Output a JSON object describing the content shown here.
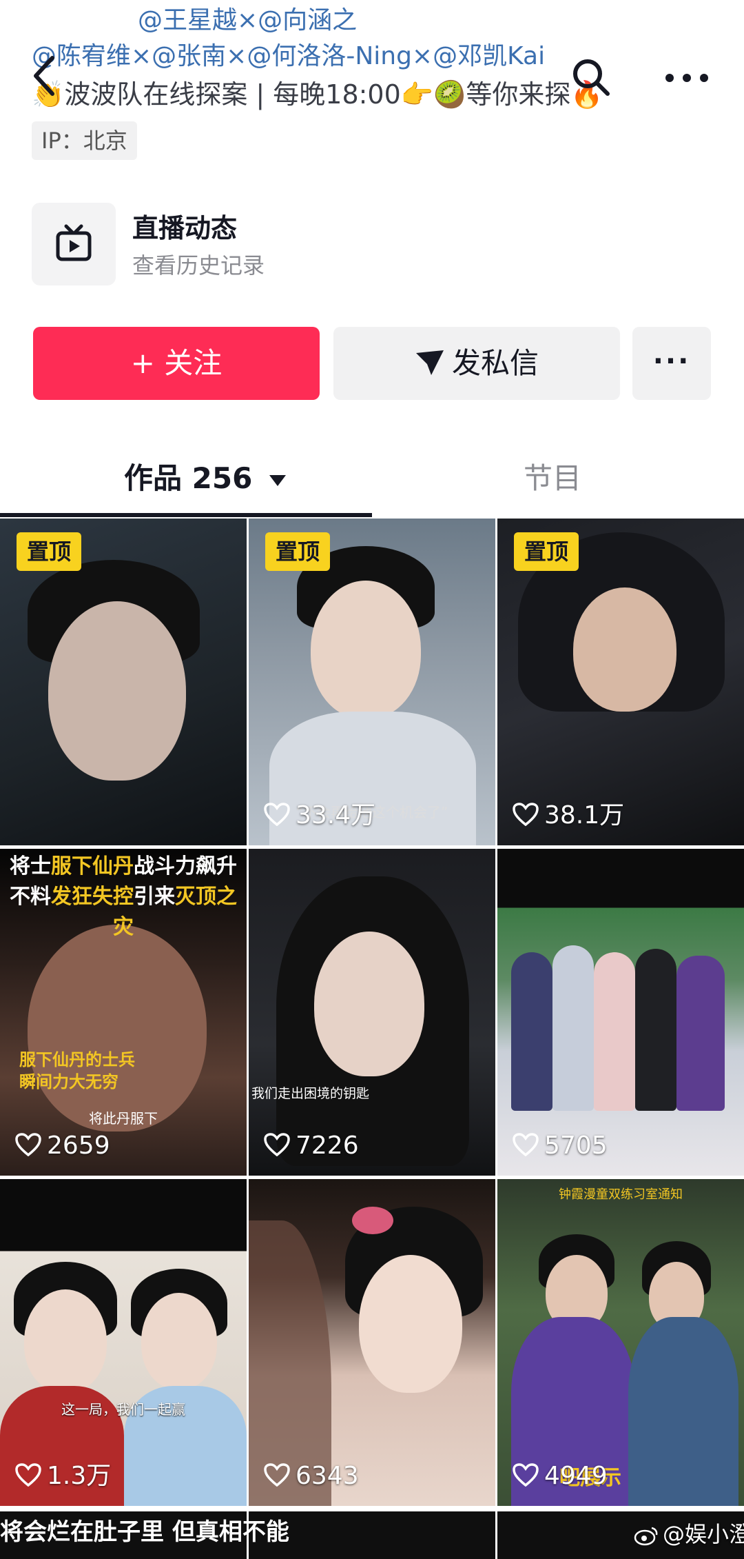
{
  "header": {
    "bio_line1": "@王星越×@向涵之",
    "bio_line2": "@陈宥维×@张南×@何洛洛-Ning×@邓凯Kai",
    "bio_line3": "👏波波队在线探案 | 每晚18:00👉🥝等你来探🔥",
    "ip_label": "IP：北京"
  },
  "live": {
    "title": "直播动态",
    "subtitle": "查看历史记录"
  },
  "actions": {
    "follow": "+ 关注",
    "message": "发私信",
    "more": "···"
  },
  "tabs": {
    "works": "作品 256",
    "programs": "节目"
  },
  "grid": {
    "pinned_label": "置顶",
    "tiles": [
      {
        "likes": "",
        "pinned": true
      },
      {
        "likes": "33.4万",
        "pinned": true,
        "caption": "“不会再给他这个机会了”"
      },
      {
        "likes": "38.1万",
        "pinned": true
      },
      {
        "likes": "2659",
        "pinned": false,
        "overlay_line1_a": "将士",
        "overlay_line1_b": "服下仙丹",
        "overlay_line1_c": "战斗力飙升",
        "overlay_line2_a": "不料",
        "overlay_line2_b": "发狂失控",
        "overlay_line2_c": "引来",
        "overlay_line2_d": "灭顶之灾",
        "caption_a": "服下仙丹的士兵",
        "caption_b": "瞬间力大无穷",
        "caption_c": "将此丹服下"
      },
      {
        "likes": "7226",
        "pinned": false,
        "caption": "我们走出困境的钥匙"
      },
      {
        "likes": "5705",
        "pinned": false
      },
      {
        "likes": "1.3万",
        "pinned": false,
        "caption": "这一局，我们一起赢"
      },
      {
        "likes": "6343",
        "pinned": false
      },
      {
        "likes": "4949",
        "pinned": false,
        "caption_top": "钟霞漫童双练习室通知",
        "caption": "吧展示"
      }
    ]
  },
  "bottom_caption": "将会烂在肚子里 但真相不能",
  "watermark": "@娱小澄"
}
